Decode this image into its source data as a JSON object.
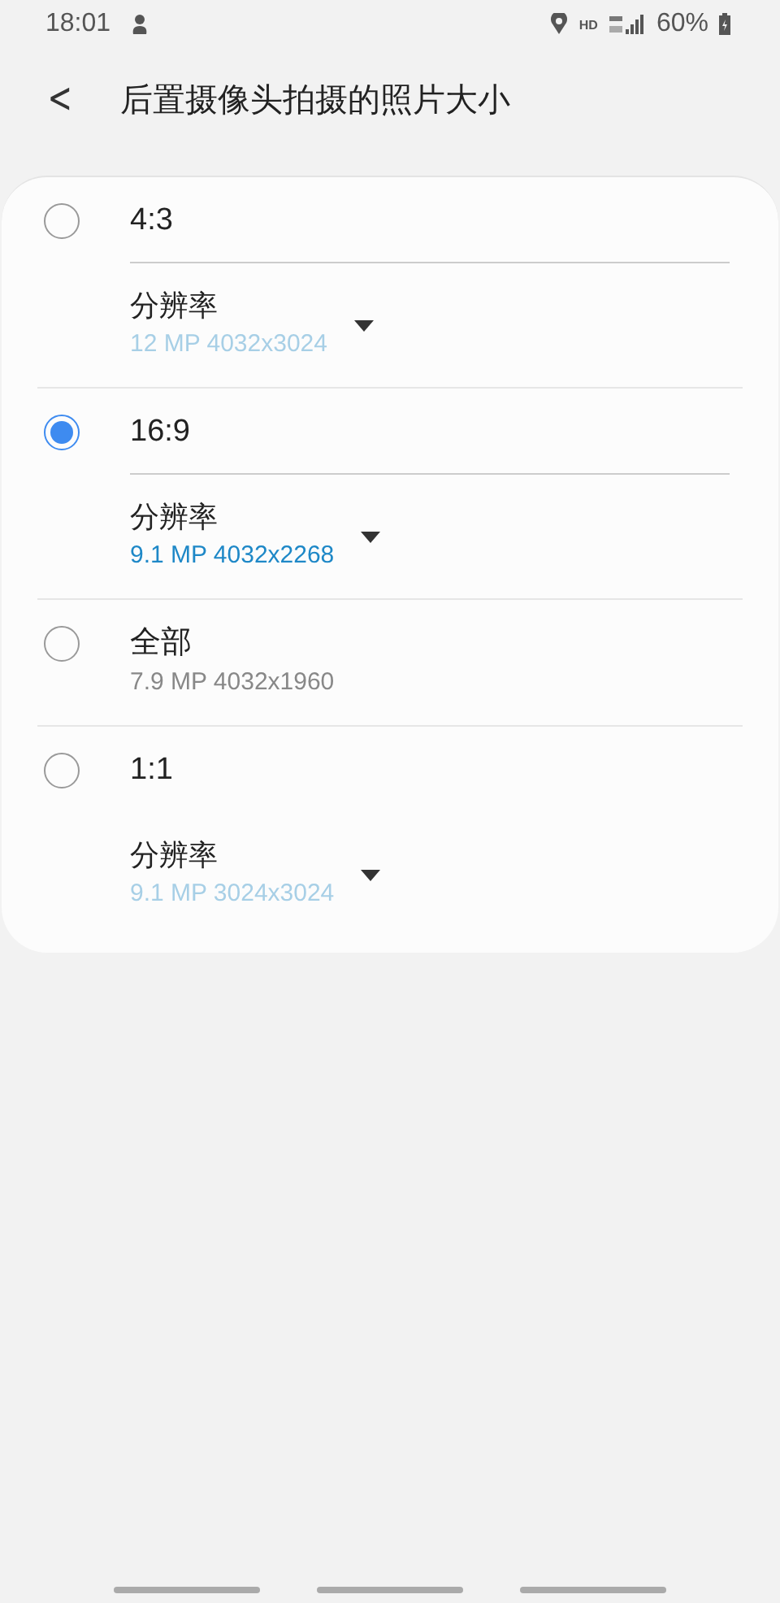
{
  "status_bar": {
    "time": "18:01",
    "network": "HD",
    "battery": "60%"
  },
  "header": {
    "back": "<",
    "title": "后置摄像头拍摄的照片大小"
  },
  "options": [
    {
      "kind": "dropdown",
      "label": "4:3",
      "selected": false,
      "divider": true,
      "field_label": "分辨率",
      "value": "12 MP  4032x3024"
    },
    {
      "kind": "dropdown",
      "label": "16:9",
      "selected": true,
      "divider": true,
      "field_label": "分辨率",
      "value": "9.1 MP  4032x2268"
    },
    {
      "kind": "plain",
      "label": "全部",
      "selected": false,
      "subtitle": "7.9 MP  4032x1960"
    },
    {
      "kind": "dropdown",
      "label": "1:1",
      "selected": false,
      "divider": false,
      "field_label": "分辨率",
      "value": "9.1 MP  3024x3024"
    }
  ]
}
